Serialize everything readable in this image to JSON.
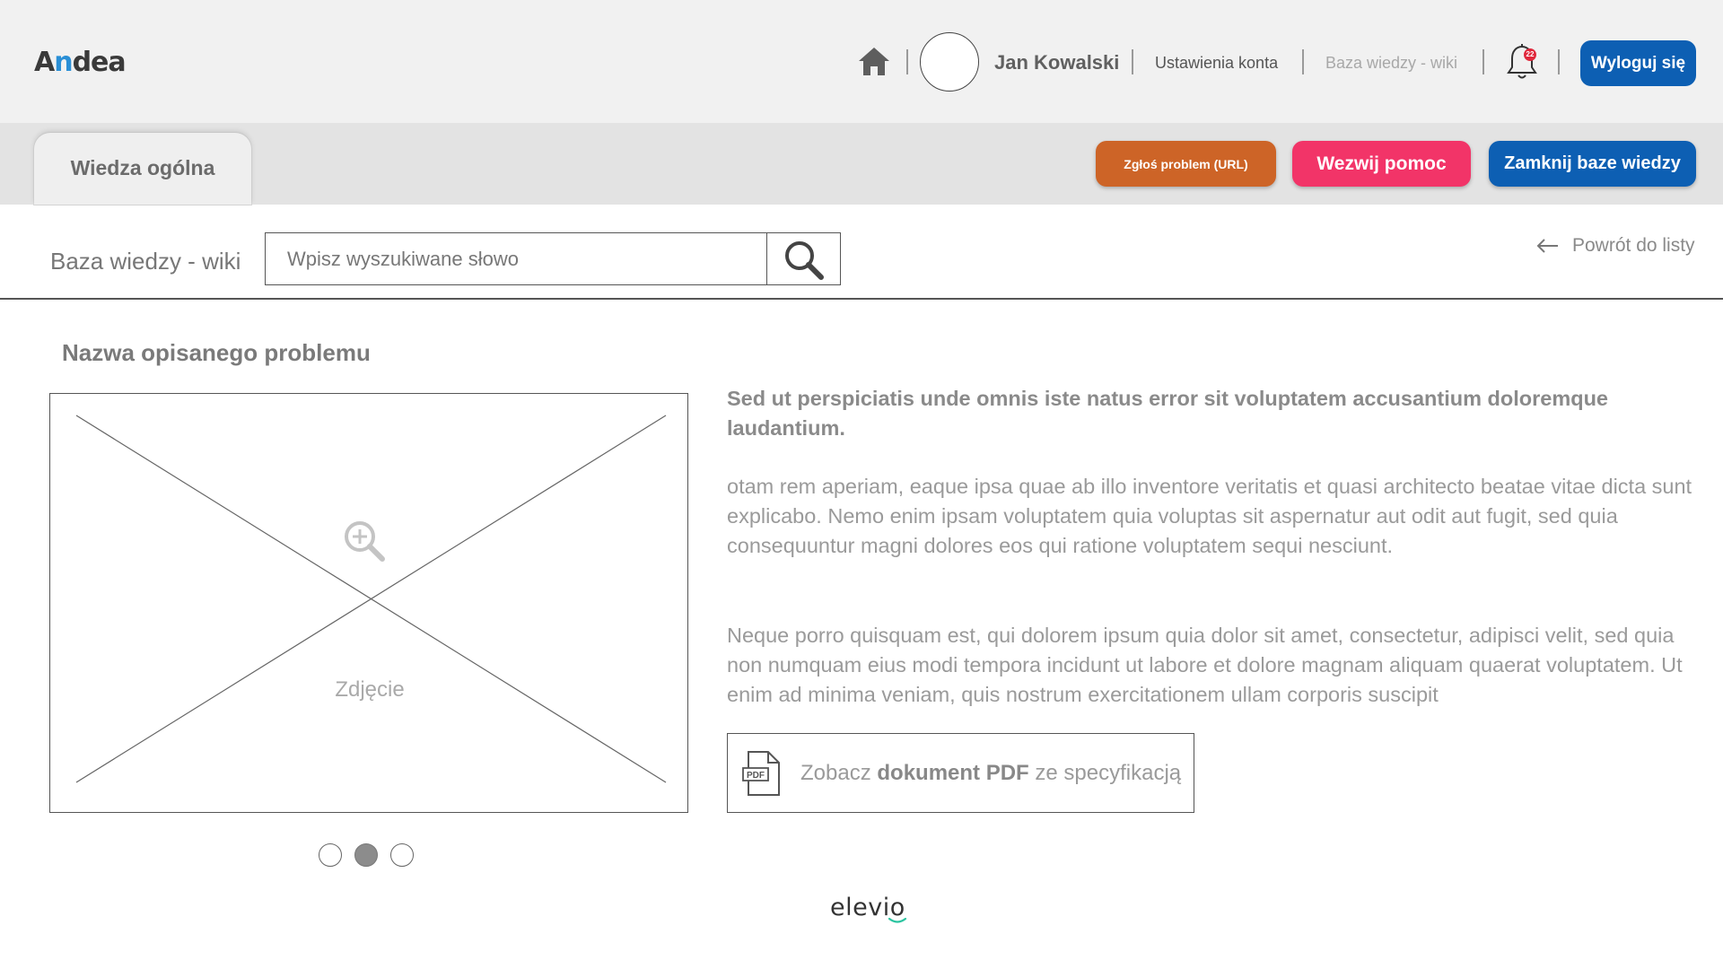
{
  "header": {
    "logo": {
      "pre": "A",
      "accent": "n",
      "post": "dea"
    },
    "user_name": "Jan Kowalski",
    "links": {
      "settings": "Ustawienia konta",
      "wiki": "Baza wiedzy - wiki"
    },
    "notifications_count": "22",
    "logout_label": "Wyloguj się"
  },
  "toolbar": {
    "tab_label": "Wiedza ogólna",
    "report_label": "Zgłoś problem (URL)",
    "help_label": "Wezwij pomoc",
    "close_label": "Zamknij baze wiedzy"
  },
  "search": {
    "label": "Baza wiedzy - wiki",
    "placeholder": "Wpisz wyszukiwane słowo",
    "back_label": "Powrót do listy"
  },
  "article": {
    "title": "Nazwa opisanego problemu",
    "image_caption": "Zdjęcie",
    "carousel": {
      "total": 3,
      "active_index": 1
    },
    "lead": "Sed ut perspiciatis unde omnis iste natus error sit voluptatem accusantium doloremque laudantium.",
    "paragraph1": "otam rem aperiam, eaque ipsa quae ab illo inventore veritatis et quasi architecto beatae vitae dicta sunt explicabo. Nemo enim ipsam voluptatem quia voluptas sit aspernatur aut odit aut fugit, sed quia consequuntur magni dolores eos qui ratione voluptatem sequi nesciunt.",
    "paragraph2": "Neque porro quisquam est, qui dolorem ipsum quia dolor sit amet, consectetur, adipisci velit, sed quia non numquam eius modi tempora incidunt ut labore et dolore magnam aliquam quaerat voluptatem. Ut enim ad minima veniam, quis nostrum exercitationem ullam corporis suscipit",
    "pdf": {
      "icon_label": "PDF",
      "pre": "Zobacz ",
      "bold": "dokument PDF",
      "post": " ze specyfikacją"
    }
  },
  "footer": {
    "brand": "elevio"
  },
  "colors": {
    "header_bg": "#f1f1f1",
    "band_bg": "#e3e3e3",
    "logout": "#0d5fb3",
    "report": "#cd6427",
    "help": "#f23468",
    "close": "#0d5fb3",
    "badge": "#e0283c",
    "logo_accent": "#2a8fd6"
  },
  "icons": {
    "home": "home-icon",
    "bell": "bell-icon",
    "search": "search-icon",
    "back": "arrow-left-icon",
    "zoom": "zoom-in-icon",
    "pdf": "pdf-file-icon"
  }
}
